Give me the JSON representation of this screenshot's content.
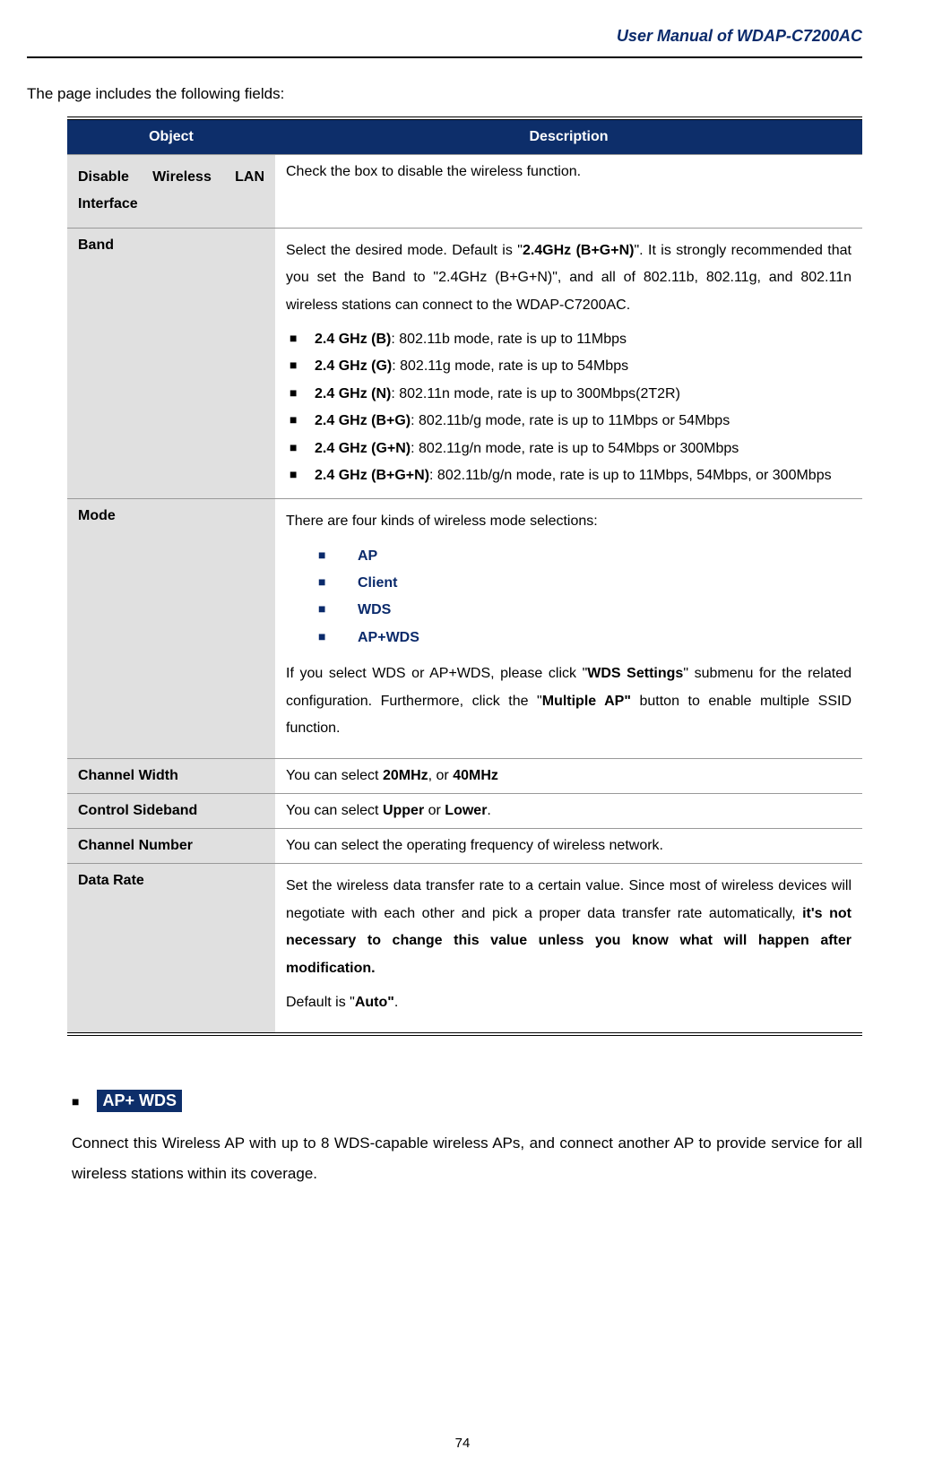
{
  "header": {
    "title": "User Manual of WDAP-C7200AC"
  },
  "intro": "The page includes the following fields:",
  "table": {
    "colObject": "Object",
    "colDescription": "Description",
    "disable": {
      "label": "Disable Wireless LAN Interface",
      "desc": "Check the box to disable the wireless function."
    },
    "band": {
      "label": "Band",
      "desc_pre": "Select the desired mode. Default is \"",
      "desc_bold1": "2.4GHz (B+G+N)",
      "desc_post": "\". It is strongly recommended that you set the Band to \"2.4GHz (B+G+N)\", and all of 802.11b, 802.11g, and 802.11n wireless stations can connect to the WDAP-C7200AC.",
      "b1_bold": "2.4 GHz (B)",
      "b1": ": 802.11b mode, rate is up to 11Mbps",
      "b2_bold": "2.4 GHz (G)",
      "b2": ": 802.11g mode, rate is up to 54Mbps",
      "b3_bold": "2.4 GHz (N)",
      "b3": ": 802.11n mode, rate is up to 300Mbps(2T2R)",
      "b4_bold": "2.4 GHz (B+G)",
      "b4": ": 802.11b/g mode, rate is up to 11Mbps or 54Mbps",
      "b5_bold": "2.4 GHz (G+N)",
      "b5": ": 802.11g/n mode, rate is up to 54Mbps or 300Mbps",
      "b6_bold": "2.4 GHz (B+G+N)",
      "b6": ": 802.11b/g/n mode, rate is up to 11Mbps, 54Mbps, or 300Mbps"
    },
    "mode": {
      "label": "Mode",
      "desc_top": "There are four kinds of wireless mode selections:",
      "m1": "AP",
      "m2": "Client",
      "m3": "WDS",
      "m4": "AP+WDS",
      "desc_bottom_pre": "If you select WDS or AP+WDS, please click \"",
      "desc_bottom_bold1": "WDS Settings",
      "desc_bottom_mid": "\" submenu for the related configuration. Furthermore, click the \"",
      "desc_bottom_bold2": "Multiple AP\"",
      "desc_bottom_post": " button to enable multiple SSID function."
    },
    "channelWidth": {
      "label": "Channel Width",
      "pre": "You can select ",
      "b1": "20MHz",
      "mid": ", or ",
      "b2": "40MHz"
    },
    "controlSideband": {
      "label": "Control Sideband",
      "pre": "You can select ",
      "b1": "Upper",
      "mid": " or ",
      "b2": "Lower",
      "post": "."
    },
    "channelNumber": {
      "label": "Channel Number",
      "desc": "You can select the operating frequency of wireless network."
    },
    "dataRate": {
      "label": "Data Rate",
      "pre": "Set the wireless data transfer rate to a certain value. Since most of wireless devices will negotiate with each other and pick a proper data transfer rate automatically, ",
      "bold": "it's not necessary to change this value unless you know what will happen after modification.",
      "default_pre": "Default is \"",
      "default_bold": "Auto\"",
      "default_post": "."
    }
  },
  "section": {
    "title": "AP+ WDS",
    "desc": "Connect this Wireless AP with up to 8 WDS-capable wireless APs, and connect another AP to provide service for all wireless stations within its coverage."
  },
  "page_number": "74"
}
